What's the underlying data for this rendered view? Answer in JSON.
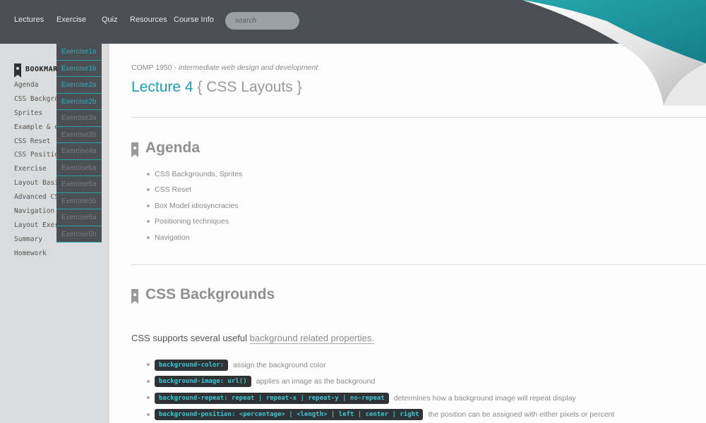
{
  "nav": {
    "items": [
      "Lectures",
      "Exercise",
      "Quiz",
      "Resources",
      "Course Info"
    ],
    "search_placeholder": "search"
  },
  "dropdown": {
    "items": [
      {
        "label": "Exercise1a",
        "active": true
      },
      {
        "label": "Exercise1b",
        "active": true
      },
      {
        "label": "Exercise2a",
        "active": true
      },
      {
        "label": "Exercise2b",
        "active": true
      },
      {
        "label": "Exercise3a",
        "active": false
      },
      {
        "label": "Exercise3b",
        "active": false
      },
      {
        "label": "Exercise4a",
        "active": false
      },
      {
        "label": "Exerciseba",
        "active": false
      },
      {
        "label": "Exercise5a",
        "active": false
      },
      {
        "label": "Exercise5b",
        "active": false
      },
      {
        "label": "Exercise6a",
        "active": false
      },
      {
        "label": "Exercise6b",
        "active": false
      }
    ]
  },
  "sidebar": {
    "title": "BOOKMARKS",
    "items": [
      "Agenda",
      "CSS Backgrounds",
      "Sprites",
      "Example & exercise",
      "CSS Reset",
      "CSS Positioning",
      "Exercise",
      "Layout Basics",
      "Advanced CSS",
      "Navigation",
      "Layout Exercise",
      "Summary",
      "Homework"
    ]
  },
  "main": {
    "course_code": "COMP 1950",
    "course_sep": " - ",
    "course_desc": "intermediate web design and development",
    "title_accent": "Lecture 4",
    "title_rest": " { CSS Layouts }",
    "agenda_title": "Agenda",
    "agenda": [
      "CSS Backgrounds, Sprites",
      "CSS Reset",
      "Box Model idiosyncracies",
      "Positioning techniques",
      "Navigation"
    ],
    "bg_title": "CSS Backgrounds",
    "intro_text": "CSS supports several useful ",
    "intro_link": "background related properties.",
    "properties": [
      {
        "code": "background-color:",
        "desc": "assign the background color"
      },
      {
        "code": "background-image: url()",
        "desc": "applies an image as the background"
      },
      {
        "code": "background-repeat: repeat | repeat-x | repeat-y | no-repeat",
        "desc": "determines how a background image will repeat display"
      },
      {
        "code": "background-position: <percentage> | <length> | left | center | right",
        "desc": "the position can be assigned with either pixels or percent"
      }
    ]
  },
  "colors": {
    "accent": "#1aa0b0",
    "topbar": "#4b4f54",
    "sidebar": "#dadbdc",
    "curl_teal": "#1a8f98"
  }
}
